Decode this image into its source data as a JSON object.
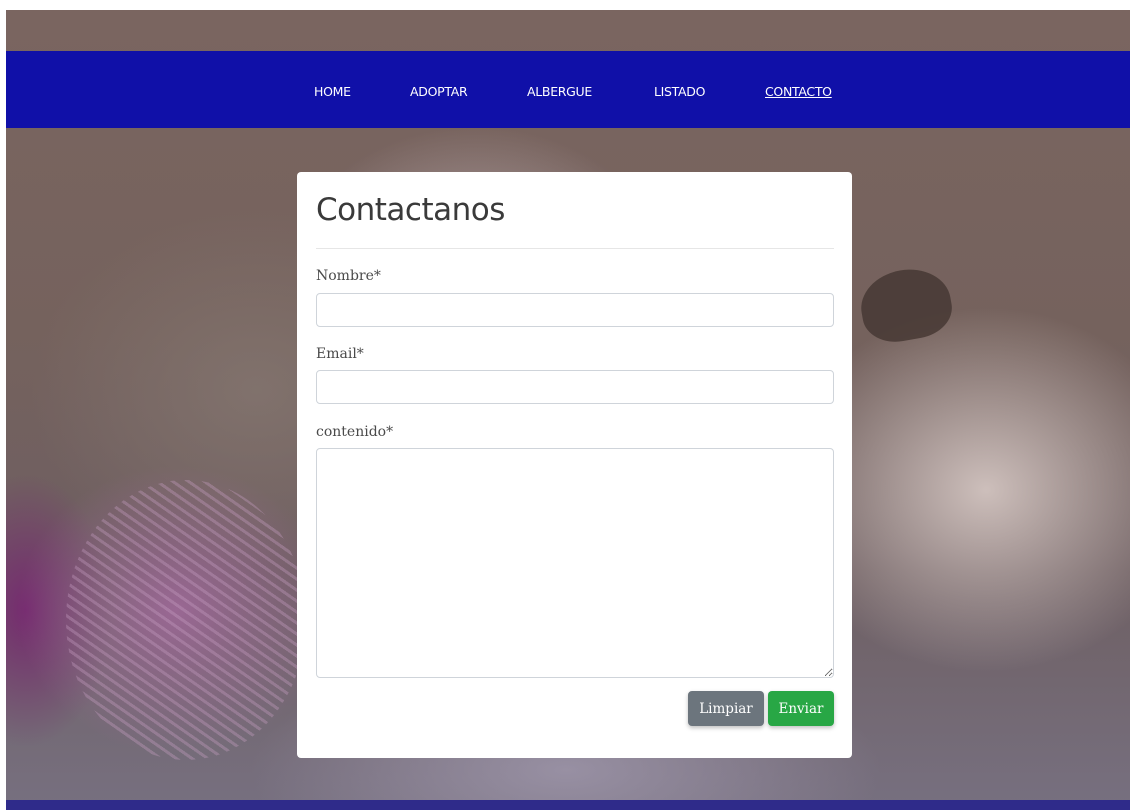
{
  "nav": {
    "items": [
      {
        "label": "HOME",
        "active": false
      },
      {
        "label": "ADOPTAR",
        "active": false
      },
      {
        "label": "ALBERGUE",
        "active": false
      },
      {
        "label": "LISTADO",
        "active": false
      },
      {
        "label": "CONTACTO",
        "active": true
      }
    ]
  },
  "form": {
    "title": "Contactanos",
    "fields": {
      "nombre": {
        "label": "Nombre*",
        "value": "",
        "placeholder": ""
      },
      "email": {
        "label": "Email*",
        "value": "",
        "placeholder": ""
      },
      "contenido": {
        "label": "contenido*",
        "value": "",
        "placeholder": ""
      }
    },
    "buttons": {
      "reset_label": "Limpiar",
      "submit_label": "Enviar"
    }
  },
  "colors": {
    "navbar": "#1010a8",
    "reset_button": "#6c757d",
    "submit_button": "#28a745",
    "card": "#ffffff"
  },
  "background": {
    "image": "kitten-with-yarn-photo"
  }
}
